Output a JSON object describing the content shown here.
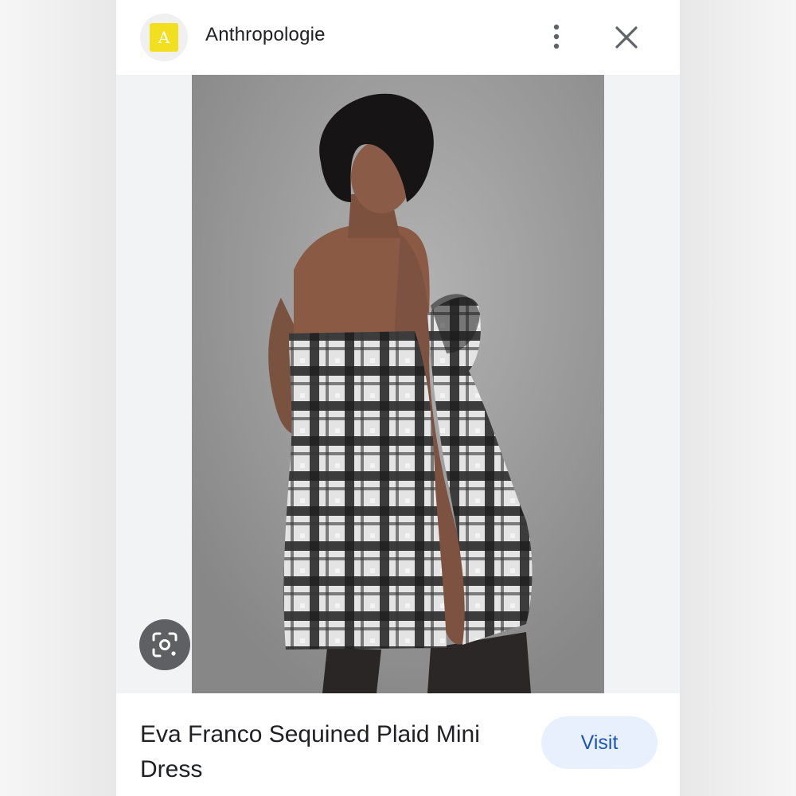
{
  "header": {
    "logo_letter": "A",
    "site_name": "Anthropologie",
    "more_icon": "more-vert-icon",
    "close_icon": "close-icon"
  },
  "image": {
    "lens_icon": "lens-icon"
  },
  "footer": {
    "title": "Eva Franco Sequined Plaid Mini Dress",
    "visit_label": "Visit"
  },
  "colors": {
    "logo_yellow": "#f2df1f",
    "visit_bg": "#e8f0fe",
    "visit_text": "#1a56b5"
  }
}
